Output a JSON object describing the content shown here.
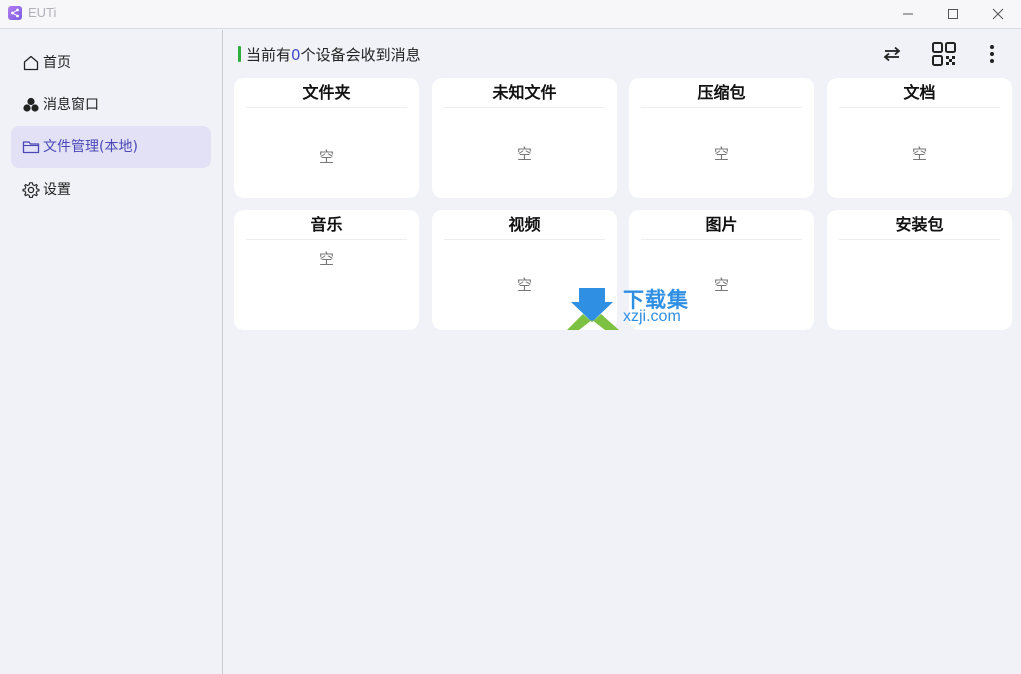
{
  "window": {
    "title": "EUTi",
    "controls": [
      "minimize-icon",
      "maximize-icon",
      "close-icon"
    ]
  },
  "sidebar": {
    "items": [
      {
        "label": "首页",
        "icon": "home-icon",
        "active": false
      },
      {
        "label": "消息窗口",
        "icon": "clover-icon",
        "active": false
      },
      {
        "label": "文件管理(本地)",
        "icon": "folder-icon",
        "active": true
      },
      {
        "label": "设置",
        "icon": "gear-icon",
        "active": false
      }
    ]
  },
  "header": {
    "prefix": "当前有",
    "count": "0",
    "suffix": "个设备会收到消息",
    "accent_color": "#2fae3f",
    "count_color": "#3d49c9",
    "tools": [
      "swap-arrows-icon",
      "qr-code-icon",
      "more-vertical-icon"
    ]
  },
  "categories": [
    {
      "title": "文件夹",
      "content": "空"
    },
    {
      "title": "未知文件",
      "content": "空"
    },
    {
      "title": "压缩包",
      "content": "空"
    },
    {
      "title": "文档",
      "content": "空"
    },
    {
      "title": "音乐",
      "content": "空"
    },
    {
      "title": "视频",
      "content": "空"
    },
    {
      "title": "图片",
      "content": "空"
    },
    {
      "title": "安装包",
      "content": ""
    }
  ],
  "watermark": {
    "line1": "下载集",
    "line2": "xzji.com"
  }
}
